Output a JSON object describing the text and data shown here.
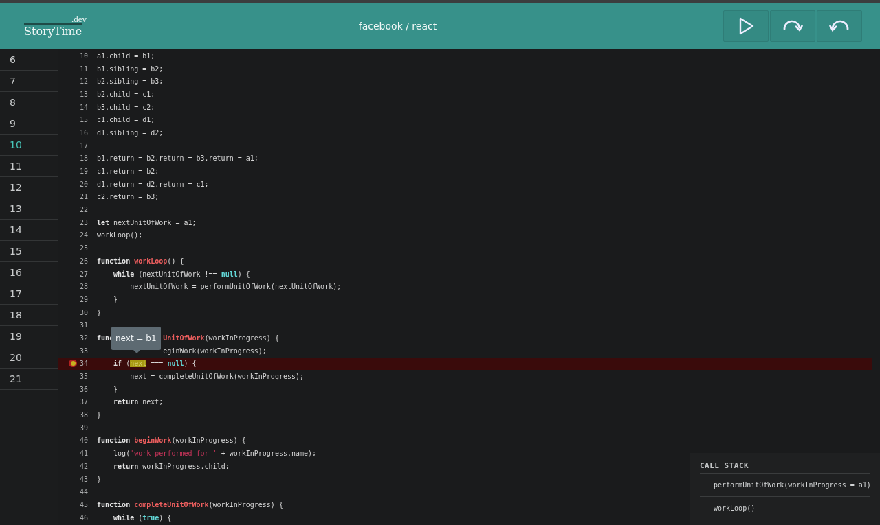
{
  "header": {
    "logo": {
      "suffix": ".dev",
      "name": "StoryTime"
    },
    "title": "facebook / react",
    "buttons": [
      {
        "kind": "play"
      },
      {
        "kind": "step-over"
      },
      {
        "kind": "step-back"
      }
    ]
  },
  "steps": [
    {
      "label": "6",
      "selected": false
    },
    {
      "label": "7",
      "selected": false
    },
    {
      "label": "8",
      "selected": false
    },
    {
      "label": "9",
      "selected": false
    },
    {
      "label": "10",
      "selected": true
    },
    {
      "label": "11",
      "selected": false
    },
    {
      "label": "12",
      "selected": false
    },
    {
      "label": "13",
      "selected": false
    },
    {
      "label": "14",
      "selected": false
    },
    {
      "label": "15",
      "selected": false
    },
    {
      "label": "16",
      "selected": false
    },
    {
      "label": "17",
      "selected": false
    },
    {
      "label": "18",
      "selected": false
    },
    {
      "label": "19",
      "selected": false
    },
    {
      "label": "20",
      "selected": false
    },
    {
      "label": "21",
      "selected": false
    }
  ],
  "lines": [
    {
      "number": "10",
      "segments": [
        {
          "text": "a1.child = b1;",
          "kind": "plain"
        }
      ]
    },
    {
      "number": "11",
      "segments": [
        {
          "text": "b1.sibling = b2;",
          "kind": "plain"
        }
      ]
    },
    {
      "number": "12",
      "segments": [
        {
          "text": "b2.sibling = b3;",
          "kind": "plain"
        }
      ]
    },
    {
      "number": "13",
      "segments": [
        {
          "text": "b2.child = c1;",
          "kind": "plain"
        }
      ]
    },
    {
      "number": "14",
      "segments": [
        {
          "text": "b3.child = c2;",
          "kind": "plain"
        }
      ]
    },
    {
      "number": "15",
      "segments": [
        {
          "text": "c1.child = d1;",
          "kind": "plain"
        }
      ]
    },
    {
      "number": "16",
      "segments": [
        {
          "text": "d1.sibling = d2;",
          "kind": "plain"
        }
      ]
    },
    {
      "number": "17"
    },
    {
      "number": "18",
      "segments": [
        {
          "text": "b1.return = b2.return = b3.return = a1;",
          "kind": "plain"
        }
      ]
    },
    {
      "number": "19",
      "segments": [
        {
          "text": "c1.return = b2;",
          "kind": "plain"
        }
      ]
    },
    {
      "number": "20",
      "segments": [
        {
          "text": "d1.return = d2.return = c1;",
          "kind": "plain"
        }
      ]
    },
    {
      "number": "21",
      "segments": [
        {
          "text": "c2.return = b3;",
          "kind": "plain"
        }
      ]
    },
    {
      "number": "22"
    },
    {
      "number": "23",
      "segments": [
        {
          "text": "let",
          "kind": "keyword"
        },
        {
          "text": " nextUnitOfWork = a1;",
          "kind": "plain"
        }
      ]
    },
    {
      "number": "24",
      "segments": [
        {
          "text": "workLoop();",
          "kind": "plain"
        }
      ]
    },
    {
      "number": "25"
    },
    {
      "number": "26",
      "segments": [
        {
          "text": "function ",
          "kind": "keyword"
        },
        {
          "text": "workLoop",
          "kind": "fn"
        },
        {
          "text": "() {",
          "kind": "plain"
        }
      ]
    },
    {
      "number": "27",
      "segments": [
        {
          "text": "    while",
          "kind": "keyword"
        },
        {
          "text": " (nextUnitOfWork !== ",
          "kind": "plain"
        },
        {
          "text": "null",
          "kind": "literal"
        },
        {
          "text": ") {",
          "kind": "plain"
        }
      ]
    },
    {
      "number": "28",
      "segments": [
        {
          "text": "        nextUnitOfWork = performUnitOfWork(nextUnitOfWork);",
          "kind": "plain"
        }
      ]
    },
    {
      "number": "29",
      "segments": [
        {
          "text": "    }",
          "kind": "plain"
        }
      ]
    },
    {
      "number": "30",
      "segments": [
        {
          "text": "}",
          "kind": "plain"
        }
      ]
    },
    {
      "number": "31"
    },
    {
      "number": "32",
      "tooltip": "next = b1",
      "segments": [
        {
          "text": "func",
          "kind": "keyword"
        },
        {
          "text": "UnitOfWork",
          "kind": "fn",
          "after_tooltip": true
        },
        {
          "text": "(workInProgress) {",
          "kind": "plain"
        }
      ]
    },
    {
      "number": "33",
      "segments": [
        {
          "text": "eginWork(workInProgress);",
          "kind": "plain",
          "after_tooltip": true
        }
      ]
    },
    {
      "number": "34",
      "breakpoint": true,
      "current": true,
      "segments": [
        {
          "text": "    if",
          "kind": "keyword"
        },
        {
          "text": " (",
          "kind": "plain"
        },
        {
          "text": "next",
          "kind": "highlight"
        },
        {
          "text": " === ",
          "kind": "plain"
        },
        {
          "text": "null",
          "kind": "literal"
        },
        {
          "text": ") {",
          "kind": "plain"
        }
      ]
    },
    {
      "number": "35",
      "segments": [
        {
          "text": "        next = completeUnitOfWork(workInProgress);",
          "kind": "plain"
        }
      ]
    },
    {
      "number": "36",
      "segments": [
        {
          "text": "    }",
          "kind": "plain"
        }
      ]
    },
    {
      "number": "37",
      "segments": [
        {
          "text": "    return",
          "kind": "keyword"
        },
        {
          "text": " next;",
          "kind": "plain"
        }
      ]
    },
    {
      "number": "38",
      "segments": [
        {
          "text": "}",
          "kind": "plain"
        }
      ]
    },
    {
      "number": "39"
    },
    {
      "number": "40",
      "segments": [
        {
          "text": "function ",
          "kind": "keyword"
        },
        {
          "text": "beginWork",
          "kind": "fn"
        },
        {
          "text": "(workInProgress) {",
          "kind": "plain"
        }
      ]
    },
    {
      "number": "41",
      "segments": [
        {
          "text": "    log(",
          "kind": "plain"
        },
        {
          "text": "'work performed for '",
          "kind": "string"
        },
        {
          "text": " + workInProgress.name);",
          "kind": "plain"
        }
      ]
    },
    {
      "number": "42",
      "segments": [
        {
          "text": "    return",
          "kind": "keyword"
        },
        {
          "text": " workInProgress.child;",
          "kind": "plain"
        }
      ]
    },
    {
      "number": "43",
      "segments": [
        {
          "text": "}",
          "kind": "plain"
        }
      ]
    },
    {
      "number": "44"
    },
    {
      "number": "45",
      "segments": [
        {
          "text": "function ",
          "kind": "keyword"
        },
        {
          "text": "completeUnitOfWork",
          "kind": "fn"
        },
        {
          "text": "(workInProgress) {",
          "kind": "plain"
        }
      ]
    },
    {
      "number": "46",
      "segments": [
        {
          "text": "    while",
          "kind": "keyword"
        },
        {
          "text": " (",
          "kind": "plain"
        },
        {
          "text": "true",
          "kind": "literal"
        },
        {
          "text": ") {",
          "kind": "plain"
        }
      ]
    }
  ],
  "call_stack": {
    "title": "CALL STACK",
    "frames": [
      "performUnitOfWork(workInProgress = a1)",
      "workLoop()"
    ]
  }
}
